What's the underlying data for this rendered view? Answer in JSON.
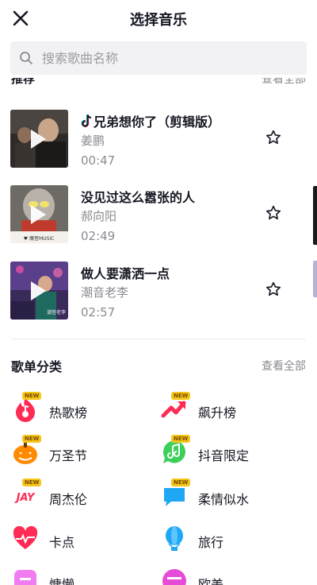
{
  "header": {
    "title": "选择音乐"
  },
  "search": {
    "placeholder": "搜索歌曲名称"
  },
  "recommend_section": {
    "title": "推荐",
    "view_all": "查看全部"
  },
  "songs": [
    {
      "title": "兄弟想你了（剪辑版）",
      "artist": "姜鹏",
      "duration": "00:47",
      "has_tiktok_mark": true
    },
    {
      "title": "没见过这么嚣张的人",
      "artist": "郝向阳",
      "duration": "02:49"
    },
    {
      "title": "做人要潇洒一点",
      "artist": "潮音老李",
      "duration": "02:57"
    }
  ],
  "categories_section": {
    "title": "歌单分类",
    "view_all": "查看全部"
  },
  "categories": [
    {
      "label": "热歌榜",
      "icon": "hot-songs-icon",
      "new": true,
      "color": "#fe2c55"
    },
    {
      "label": "飙升榜",
      "icon": "rising-chart-icon",
      "new": true,
      "color": "#fe2c55"
    },
    {
      "label": "万圣节",
      "icon": "pumpkin-icon",
      "new": true,
      "color": "#ff8a00"
    },
    {
      "label": "抖音限定",
      "icon": "music-bubble-icon",
      "new": true,
      "color": "#3ccf5a"
    },
    {
      "label": "周杰伦",
      "icon": "jay-icon",
      "new": true,
      "color": "#fe2c55"
    },
    {
      "label": "柔情似水",
      "icon": "chat-bubble-icon",
      "new": true,
      "color": "#1ea7f5"
    },
    {
      "label": "卡点",
      "icon": "heartbeat-icon",
      "new": false,
      "color": "#fe2c55"
    },
    {
      "label": "旅行",
      "icon": "balloon-icon",
      "new": false,
      "color": "#1ea7f5"
    },
    {
      "label": "慵懒",
      "icon": "lazy-icon",
      "new": false,
      "color": "#f07cf0"
    },
    {
      "label": "欧美",
      "icon": "western-icon",
      "new": false,
      "color": "#e64bd8"
    }
  ],
  "badge_text": "NEW",
  "cover_texts": {
    "song_2": "♥ 魔音MUSIC",
    "song_3": "潮音老李"
  }
}
